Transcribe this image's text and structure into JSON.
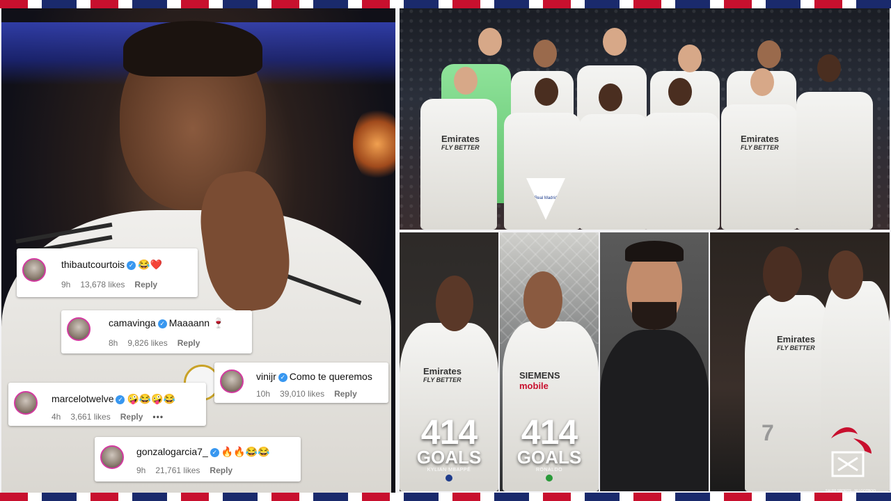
{
  "left_photo": {
    "comments": [
      {
        "username": "thibautcourtois",
        "text": "😂❤️",
        "time": "9h",
        "likes": "13,678 likes",
        "reply": "Reply"
      },
      {
        "username": "camavinga",
        "text": "Maaaann 🍷",
        "time": "8h",
        "likes": "9,826 likes",
        "reply": "Reply"
      },
      {
        "username": "vinijr",
        "text": "Como te queremos",
        "time": "10h",
        "likes": "39,010 likes",
        "reply": "Reply"
      },
      {
        "username": "marcelotwelve",
        "text": "🤪😂🤪😂",
        "time": "4h",
        "likes": "3,661 likes",
        "reply": "Reply",
        "more": "•••"
      },
      {
        "username": "gonzalogarcia7_",
        "text": "🔥🔥😂😂",
        "time": "9h",
        "likes": "21,761 likes",
        "reply": "Reply"
      }
    ]
  },
  "team_photo": {
    "sponsor": "Emirates",
    "sponsor_sub": "FLY BETTER",
    "pennant": "Real Madrid"
  },
  "goals_panels": [
    {
      "number": "414",
      "word": "GOALS",
      "name": "KYLIAN MBAPPÉ",
      "sponsor": "Emirates",
      "sponsor_sub": "FLY BETTER",
      "flag_color": "#1f3c8c"
    },
    {
      "number": "414",
      "word": "GOALS",
      "name": "RONALDO",
      "sponsor": "SIEMENS",
      "sponsor_sub": "mobile",
      "flag_color": "#2a9a3a"
    }
  ],
  "duo_photo": {
    "sponsor": "Emirates",
    "sponsor_sub": "FLY BETTER",
    "number": "7"
  },
  "watermark": {
    "text": "SAURI SPORTS · NU GOTBOO"
  }
}
